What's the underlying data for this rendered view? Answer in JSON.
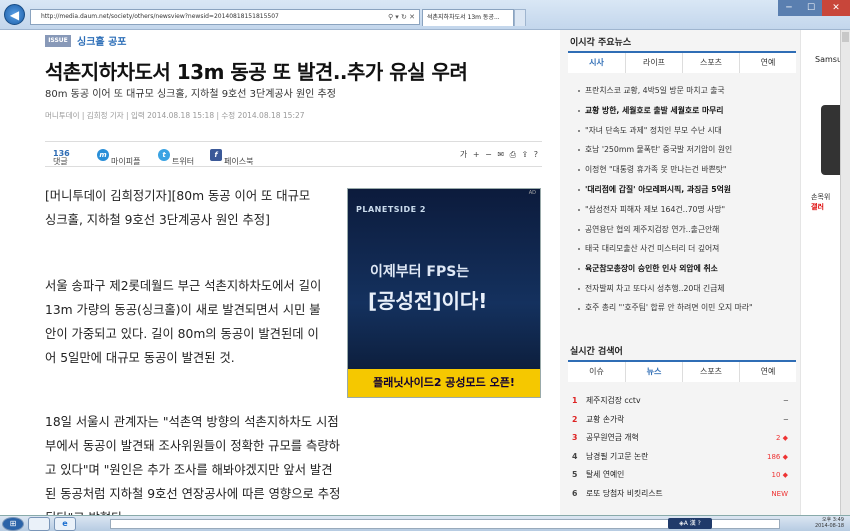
{
  "browser": {
    "address": "http://media.daum.net/society/others/newsview?newsid=20140818151815507",
    "tab_title": "석촌지하차도서 13m 동공...",
    "back_glyph": "◀",
    "fwd_glyph": "▶",
    "addr_tools": "⚲ ▾ ↻ ✕",
    "window_controls": [
      "─",
      "☐",
      "✕"
    ]
  },
  "article": {
    "issue_badge": "ISSUE",
    "issue_label": "싱크홀 공포",
    "title": "석촌지하차도서 13m 동공 또 발견..추가 유실 우려",
    "subtitle": "80m 동공 이어 또 대규모 싱크홀, 지하철 9호선 3단계공사 원인 추정",
    "meta": "머니투데이  |  김희정 기자  |  입력 2014.08.18 15:18  |  수정 2014.08.18 15:27",
    "share": {
      "comments_label": "댓글",
      "comments_count": "136",
      "mypeople": "마이피플",
      "twitter": "트위터",
      "facebook": "페이스북",
      "tools": "가 + − ✉ ⎙ ⇪ ?"
    },
    "p1": "[머니투데이 김희정기자][80m 동공 이어 또 대규모 싱크홀, 지하철 9호선 3단계공사 원인 추정]",
    "p2": "서울 송파구 제2롯데월드 부근 석촌지하차도에서 길이 13m 가량의 동공(싱크홀)이 새로 발견되면서 시민 불안이 가중되고 있다. 길이 80m의 동공이 발견된데 이어 5일만에 대규모 동공이 발견된 것.",
    "p3": "18일 서울시 관계자는 \"석촌역 방향의 석촌지하차도 시점부에서 동공이 발견돼 조사위원들이 정확한 규모를 측량하고 있다\"며 \"원인은 추가 조사를 해봐야겠지만 앞서 발견된 동공처럼 지하철 9호선 연장공사에 따른 영향으로 추정된다\"고 밝혔다."
  },
  "ad": {
    "label": "AD",
    "logo": "PLANETSIDE 2",
    "line1": "이제부터 FPS는",
    "line2": "[공성전]이다!",
    "cta": "플래닛사이드2 공성모드 오픈!"
  },
  "right": {
    "section_title": "이시각 주요뉴스",
    "tabs": [
      "시사",
      "라이프",
      "스포츠",
      "연예"
    ],
    "news": [
      {
        "t": "프란치스코 교황, 4박5일 방문 마치고 출국",
        "b": false
      },
      {
        "t": "교황 방한, 세월호로 출발 세월호로 마무리",
        "b": true
      },
      {
        "t": "\"자녀 단속도 과제\" 정치인 부모 수난 시대",
        "b": false
      },
      {
        "t": "호남 '250mm 물폭탄' 중국발 저기압이 원인",
        "b": false
      },
      {
        "t": "이정현 \"대통령 휴가족 못 만나는건 바쁜탓\"",
        "b": false
      },
      {
        "t": "'대리점에 갑질' 아모레퍼시픽, 과징금 5억원",
        "b": true
      },
      {
        "t": "\"삼성전자 피해자 제보 164건..70명 사망\"",
        "b": false
      },
      {
        "t": "공연용단 협의 제주지검장 연가..출근안해",
        "b": false
      },
      {
        "t": "태국 대리모출산 사건 미스터리 더 깊어져",
        "b": false
      },
      {
        "t": "육군참모총장이 승인한 인사 외압에 취소",
        "b": true
      },
      {
        "t": "전자발찌 차고 또다시 성추행..20대 긴급체",
        "b": false
      },
      {
        "t": "호주 총리 \"'호주팀' 합류 안 하려면 이민 오지 마라\"",
        "b": false
      }
    ],
    "realtime_title": "실시간 검색어",
    "rt_tabs": [
      "이슈",
      "뉴스",
      "스포츠",
      "연예"
    ],
    "realtime": [
      {
        "n": "1",
        "t": "제주지검장 cctv",
        "v": "─"
      },
      {
        "n": "2",
        "t": "교황 손가락",
        "v": "─"
      },
      {
        "n": "3",
        "t": "공무원연금 개혁",
        "v": "2 ◆"
      },
      {
        "n": "4",
        "t": "남경필 기고문 논란",
        "v": "186 ◆"
      },
      {
        "n": "5",
        "t": "탈세 연예인",
        "v": "10 ◆"
      },
      {
        "n": "6",
        "t": "로또 당첨자 비킷리스트",
        "v": "NEW"
      }
    ]
  },
  "side_ad": {
    "brand": "Samsu",
    "line1": "손목위",
    "line2": "갤러"
  },
  "taskbar": {
    "start_glyph": "⊞",
    "ie_glyph": "e",
    "clock_time": "오후 3:49",
    "clock_date": "2014-08-18",
    "sys": "◈A 漢 ?"
  },
  "colors": {
    "accent": "#2f6db5",
    "ad_yellow": "#f5c800"
  }
}
